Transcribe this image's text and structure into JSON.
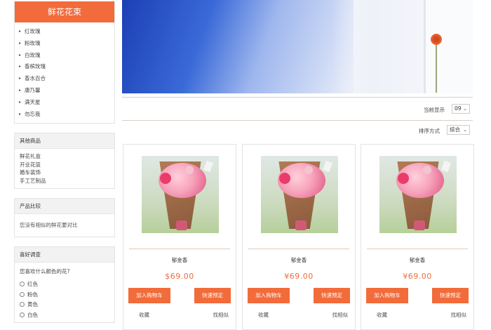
{
  "sidebar": {
    "category_title": "鲜花花束",
    "categories": [
      "红玫瑰",
      "粉玫瑰",
      "白玫瑰",
      "香槟玫瑰",
      "香水百合",
      "康乃馨",
      "满天星",
      "勿忘我"
    ],
    "other": {
      "title": "其他商品",
      "items": [
        "鲜花礼盒",
        "开业花篮",
        "婚车装饰",
        "手工艺制品"
      ]
    },
    "compare": {
      "title": "产品比较",
      "text": "您没有相似的鲜花要对比"
    },
    "survey": {
      "title": "喜好调查",
      "question": "您喜欢什么颜色的花?",
      "options": [
        "红色",
        "粉色",
        "黄色",
        "白色"
      ]
    }
  },
  "toolbar": {
    "per_page_label": "当前显示",
    "per_page_value": "09",
    "sort_label": "排序方式",
    "sort_value": "综合"
  },
  "products": [
    {
      "name": "郁金香",
      "price": "$69.00",
      "cart_label": "加入购物车",
      "buy_label": "快速预定",
      "fav_label": "收藏",
      "similar_label": "找相似"
    },
    {
      "name": "郁金香",
      "price": "¥69.00",
      "cart_label": "加入购物车",
      "buy_label": "快速预定",
      "fav_label": "收藏",
      "similar_label": "找相似"
    },
    {
      "name": "郁金香",
      "price": "¥69.00",
      "cart_label": "加入购物车",
      "buy_label": "快速预定",
      "fav_label": "收藏",
      "similar_label": "找相似"
    }
  ],
  "colors": {
    "accent": "#f26b3a",
    "border": "#e3e3e3"
  }
}
